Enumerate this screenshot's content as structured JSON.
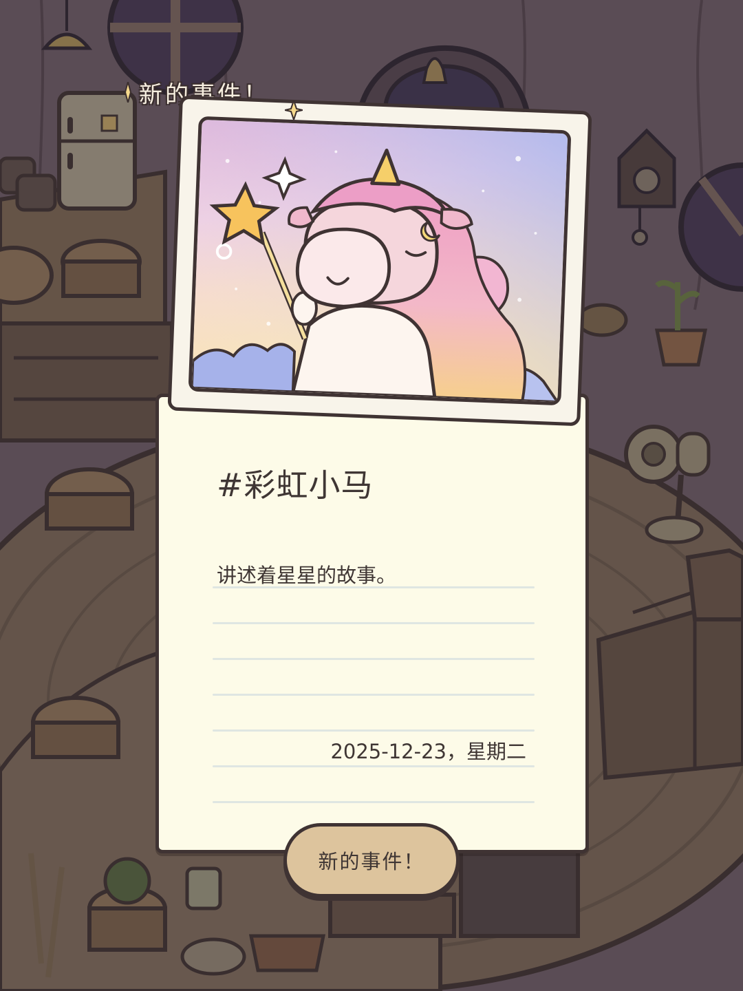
{
  "header": {
    "event_label": "新的事件！"
  },
  "card": {
    "title": "#彩虹小马",
    "description": "讲述着星星的故事。",
    "date": "2025-12-23，星期二"
  },
  "button": {
    "label": "新的事件！"
  },
  "colors": {
    "card_bg": "#fdfbe8",
    "outline": "#3f3333",
    "button_bg": "#ddc49d",
    "room_overlay": "#5e5058"
  }
}
